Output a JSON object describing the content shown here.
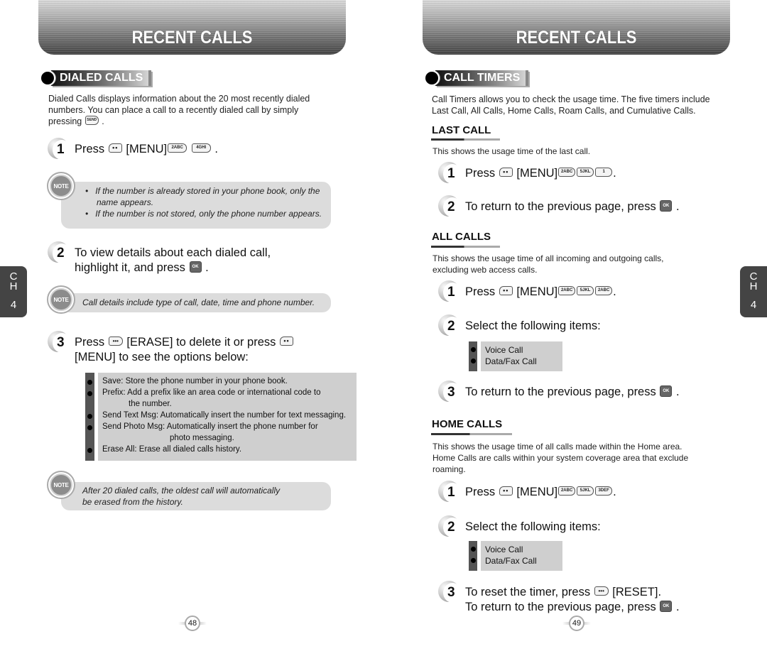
{
  "left_page": {
    "banner_title": "RECENT CALLS",
    "section_title": "DIALED CALLS",
    "intro_line1": "Dialed Calls displays information about the 20 most recently dialed",
    "intro_line2": "numbers. You can place a call to a recently dialed call by simply",
    "intro_line3": "pressing",
    "steps": [
      {
        "num": "1",
        "text_a": "Press",
        "text_b": "[MENU]",
        "keys": [
          "2ABC",
          "4GHI"
        ],
        "text_end": "."
      },
      {
        "num": "2",
        "line1": "To view details about each dialed call,",
        "line2": "highlight it, and press",
        "text_end": "."
      },
      {
        "num": "3",
        "text_a": "Press",
        "text_b": "[ERASE] to delete it or press",
        "line2": "[MENU] to see the options below:"
      }
    ],
    "note1": {
      "label": "NOTE",
      "bullets": [
        "If the number is already stored in your phone book, only the",
        "name appears.",
        "If the number is not stored, only the phone number appears."
      ]
    },
    "note2": {
      "label": "NOTE",
      "text": "Call details include type of call, date, time and phone number."
    },
    "options": [
      "Save: Store the phone number in your phone book.",
      "Prefix: Add a prefix like an area code or international code to",
      "the number.",
      "Send Text Msg: Automatically insert the number for text messaging.",
      "Send Photo Msg: Automatically insert the phone number for",
      "photo messaging.",
      "Erase All: Erase all dialed calls history."
    ],
    "note3": {
      "label": "NOTE",
      "line1": "After 20 dialed calls, the oldest call will automatically",
      "line2": "be erased from the history."
    },
    "page_number": "48",
    "chapter_tab": {
      "c": "C",
      "h": "H",
      "num": "4"
    }
  },
  "right_page": {
    "banner_title": "RECENT CALLS",
    "section_title": "CALL TIMERS",
    "intro_line1": "Call Timers allows you to check the usage time. The five timers include",
    "intro_line2": "Last Call, All Calls, Home Calls, Roam Calls, and Cumulative Calls.",
    "last_call": {
      "heading": "LAST CALL",
      "desc": "This shows the usage time of the last call.",
      "step1": {
        "num": "1",
        "text_a": "Press",
        "text_b": "[MENU]",
        "keys": [
          "2ABC",
          "5JKL",
          "1"
        ],
        "text_end": "."
      },
      "step2": {
        "num": "2",
        "text": "To return to the previous page, press",
        "text_end": "."
      }
    },
    "all_calls": {
      "heading": "ALL CALLS",
      "desc_line1": "This shows the usage time of all incoming and outgoing calls,",
      "desc_line2": "excluding web access calls.",
      "step1": {
        "num": "1",
        "text_a": "Press",
        "text_b": "[MENU]",
        "keys": [
          "2ABC",
          "5JKL",
          "2ABC"
        ],
        "text_end": "."
      },
      "step2": {
        "num": "2",
        "text": "Select the following items:"
      },
      "items": [
        "Voice Call",
        "Data/Fax Call"
      ],
      "step3": {
        "num": "3",
        "text": "To return to the previous page, press",
        "text_end": "."
      }
    },
    "home_calls": {
      "heading": "HOME CALLS",
      "desc_line1": "This shows the usage time of all calls made within the Home area.",
      "desc_line2": "Home Calls are calls within your system coverage area that exclude",
      "desc_line3": "roaming.",
      "step1": {
        "num": "1",
        "text_a": "Press",
        "text_b": "[MENU]",
        "keys": [
          "2ABC",
          "5JKL",
          "3DEF"
        ],
        "text_end": "."
      },
      "step2": {
        "num": "2",
        "text": "Select the following items:"
      },
      "items": [
        "Voice Call",
        "Data/Fax Call"
      ],
      "step3": {
        "num": "3",
        "line1": "To reset the timer, press",
        "line1_b": "[RESET].",
        "line2": "To return to the previous page, press",
        "text_end": "."
      }
    },
    "page_number": "49",
    "chapter_tab": {
      "c": "C",
      "h": "H",
      "num": "4"
    }
  },
  "key_labels": {
    "menu": "••",
    "ok": "OK",
    "erase": "•••",
    "send": "SEND"
  }
}
